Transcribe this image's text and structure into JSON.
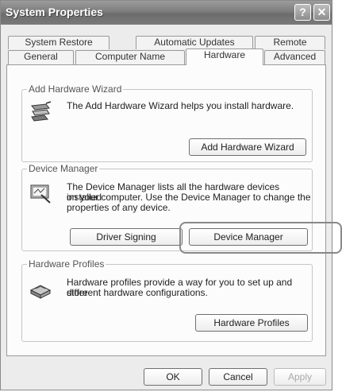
{
  "window": {
    "title": "System Properties",
    "help_glyph": "?",
    "close_glyph": "✕"
  },
  "tabs": {
    "row_top": [
      "System Restore",
      "Automatic Updates",
      "Remote"
    ],
    "row_bottom": [
      "General",
      "Computer Name",
      "Hardware",
      "Advanced"
    ],
    "active": "Hardware"
  },
  "add_hardware": {
    "legend": "Add Hardware Wizard",
    "description": "The Add Hardware Wizard helps you install hardware.",
    "button": "Add Hardware Wizard",
    "icon": "wizard-icon"
  },
  "device_manager": {
    "legend": "Device Manager",
    "description_lines": [
      "The Device Manager lists all the hardware devices installed",
      "on your computer. Use the Device Manager to change the",
      "properties of any device."
    ],
    "driver_button": "Driver Signing",
    "dm_button": "Device Manager",
    "icon": "device-manager-icon"
  },
  "hardware_profiles": {
    "legend": "Hardware Profiles",
    "description_lines": [
      "Hardware profiles provide a way for you to set up and store",
      "different hardware configurations."
    ],
    "button": "Hardware Profiles",
    "icon": "hardware-profiles-icon"
  },
  "footer": {
    "ok": "OK",
    "cancel": "Cancel",
    "apply": "Apply"
  }
}
